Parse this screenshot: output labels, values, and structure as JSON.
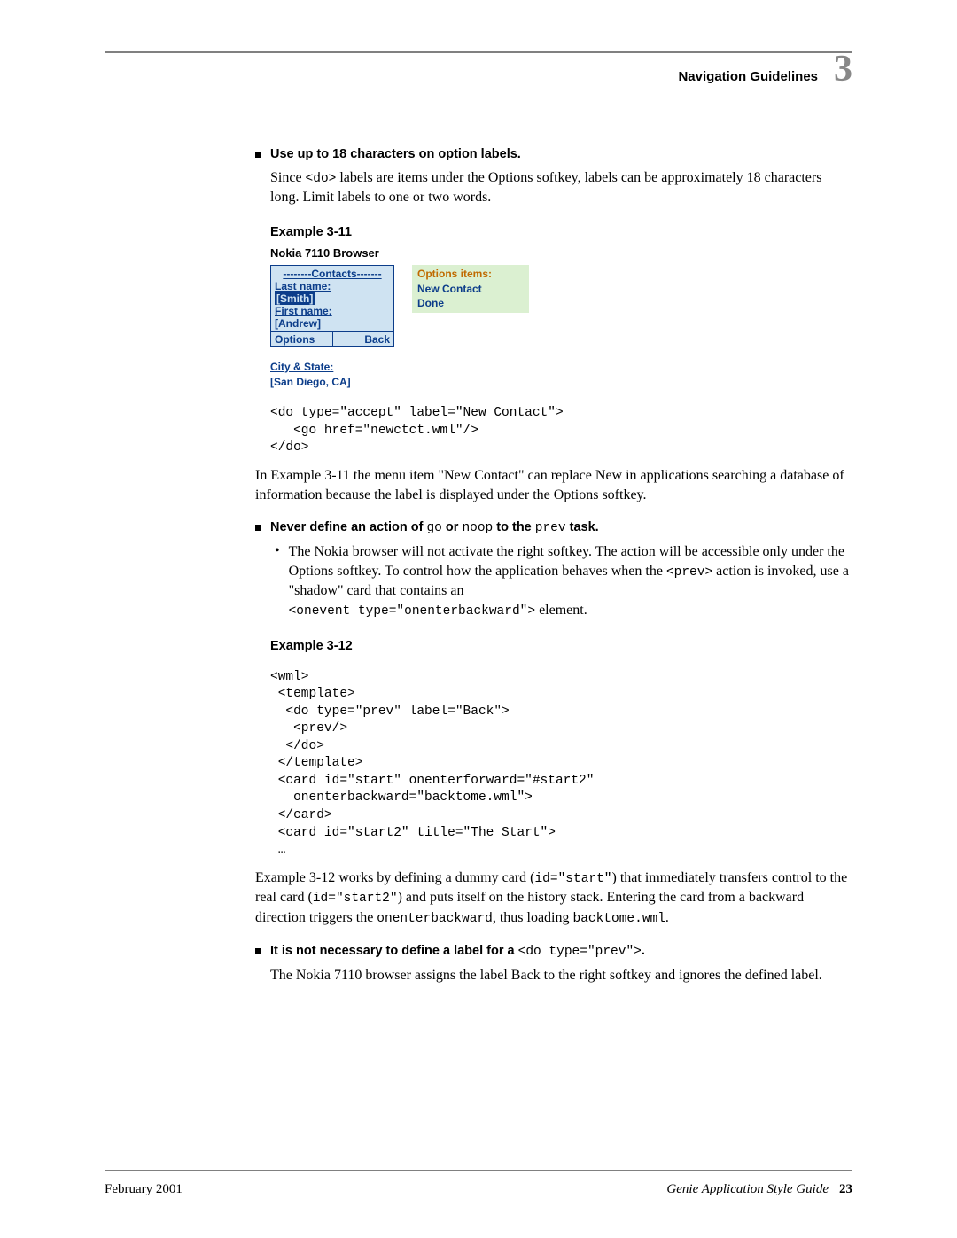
{
  "header": {
    "title": "Navigation Guidelines",
    "chapter": "3"
  },
  "bullet1": {
    "heading": "Use up to 18 characters on option labels.",
    "para_before": "Since ",
    "para_code": "<do>",
    "para_after": " labels are items under the Options softkey, labels can be approximately 18 characters long. Limit labels to one or two words."
  },
  "example311": {
    "label": "Example 3-11",
    "browser": "Nokia 7110 Browser",
    "phone": {
      "title": "--------Contacts-------",
      "line1": "Last name:",
      "selected": "[Smith]",
      "line2": "First name:",
      "line3": "[Andrew]",
      "soft_left": "Options",
      "soft_right": "Back"
    },
    "options": {
      "header": "Options items:",
      "item1": "New Contact",
      "item2": "Done"
    },
    "extra_line1": "City & State:",
    "extra_line2": "[San Diego, CA]",
    "code": "<do type=\"accept\" label=\"New Contact\">\n   <go href=\"newctct.wml\"/>\n</do>",
    "followup": "In Example 3-11 the menu item \"New Contact\" can replace New in applications searching a database of information because the label is displayed under the Options softkey."
  },
  "bullet2": {
    "t1": "Never define an action of ",
    "c1": "go",
    "t2": " or ",
    "c2": "noop",
    "t3": " to the ",
    "c3": "prev",
    "t4": " task.",
    "sub_t1": "The Nokia browser will not activate the right softkey. The action will be accessible only under the Options softkey. To control how the application behaves when the ",
    "sub_c1": "<prev>",
    "sub_t2": " action is invoked, use a \"shadow\" card that contains an ",
    "sub_c2": "<onevent type=\"onenterbackward\">",
    "sub_t3": " element."
  },
  "example312": {
    "label": "Example 3-12",
    "code": "<wml>\n <template>\n  <do type=\"prev\" label=\"Back\">\n   <prev/>\n  </do>\n </template>\n <card id=\"start\" onenterforward=\"#start2\"\n   onenterbackward=\"backtome.wml\">\n </card>\n <card id=\"start2\" title=\"The Start\">\n …",
    "f_t1": "Example 3-12 works by defining a dummy card (",
    "f_c1": "id=\"start\"",
    "f_t2": ") that immediately transfers control to the real card (",
    "f_c2": "id=\"start2\"",
    "f_t3": ") and puts itself on the history stack. Entering the card from a backward direction triggers the ",
    "f_c3": "onenterbackward",
    "f_t4": ", thus loading ",
    "f_c4": "backtome.wml",
    "f_t5": "."
  },
  "bullet3": {
    "t1": "It is not necessary to define a label for a ",
    "c1": "<do type=\"prev\">",
    "t2": ".",
    "para": "The Nokia 7110 browser assigns the label Back to the right softkey and ignores the defined label."
  },
  "footer": {
    "left": "February 2001",
    "right_title": "Genie Application Style Guide",
    "page": "23"
  }
}
